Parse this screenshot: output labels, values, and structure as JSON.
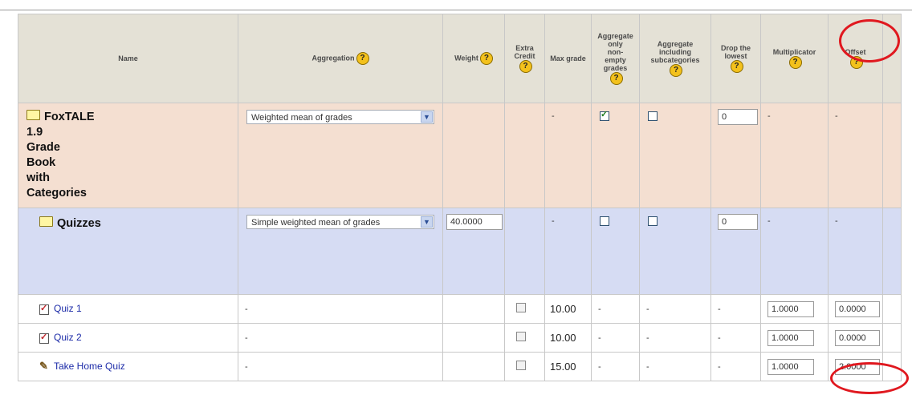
{
  "columns": {
    "name": "Name",
    "aggregation": "Aggregation",
    "weight": "Weight",
    "extra_credit": [
      "Extra",
      "Credit"
    ],
    "max_grade": "Max grade",
    "aggregate_only_nonempty": [
      "Aggregate",
      "only",
      "non-",
      "empty",
      "grades"
    ],
    "aggregate_subcategories": [
      "Aggregate",
      "including",
      "subcategories"
    ],
    "drop_lowest": [
      "Drop the",
      "lowest"
    ],
    "multiplicator": "Multiplicator",
    "offset": "Offset",
    "help_glyph": "?"
  },
  "course": {
    "name_lines": [
      "FoxTALE",
      "1.9",
      "Grade",
      "Book",
      "with",
      "Categories"
    ],
    "aggregation": "Weighted mean of grades",
    "max_grade": "-",
    "aggregate_only_nonempty": true,
    "aggregate_subcategories": false,
    "drop_lowest": "0",
    "multiplicator": "-",
    "offset": "-"
  },
  "category": {
    "name": "Quizzes",
    "aggregation": "Simple weighted mean of grades",
    "weight": "40.0000",
    "max_grade": "-",
    "aggregate_only_nonempty": false,
    "aggregate_subcategories": false,
    "drop_lowest": "0",
    "multiplicator": "-",
    "offset": "-"
  },
  "items": [
    {
      "name": "Quiz 1",
      "aggregation": "-",
      "max_grade": "10.00",
      "nonempty": "-",
      "subcats": "-",
      "drop": "-",
      "multiplicator": "1.0000",
      "offset": "0.0000"
    },
    {
      "name": "Quiz 2",
      "aggregation": "-",
      "max_grade": "10.00",
      "nonempty": "-",
      "subcats": "-",
      "drop": "-",
      "multiplicator": "1.0000",
      "offset": "0.0000"
    },
    {
      "name": "Take Home Quiz",
      "aggregation": "-",
      "max_grade": "15.00",
      "nonempty": "-",
      "subcats": "-",
      "drop": "-",
      "multiplicator": "1.0000",
      "offset": "2.0000"
    }
  ],
  "colors": {
    "annotation_ring": "#e0181f",
    "header_bg": "#e4e1d6",
    "course_bg": "#f4dfd1",
    "category_bg": "#d6dcf3",
    "link": "#1c2ba8"
  }
}
